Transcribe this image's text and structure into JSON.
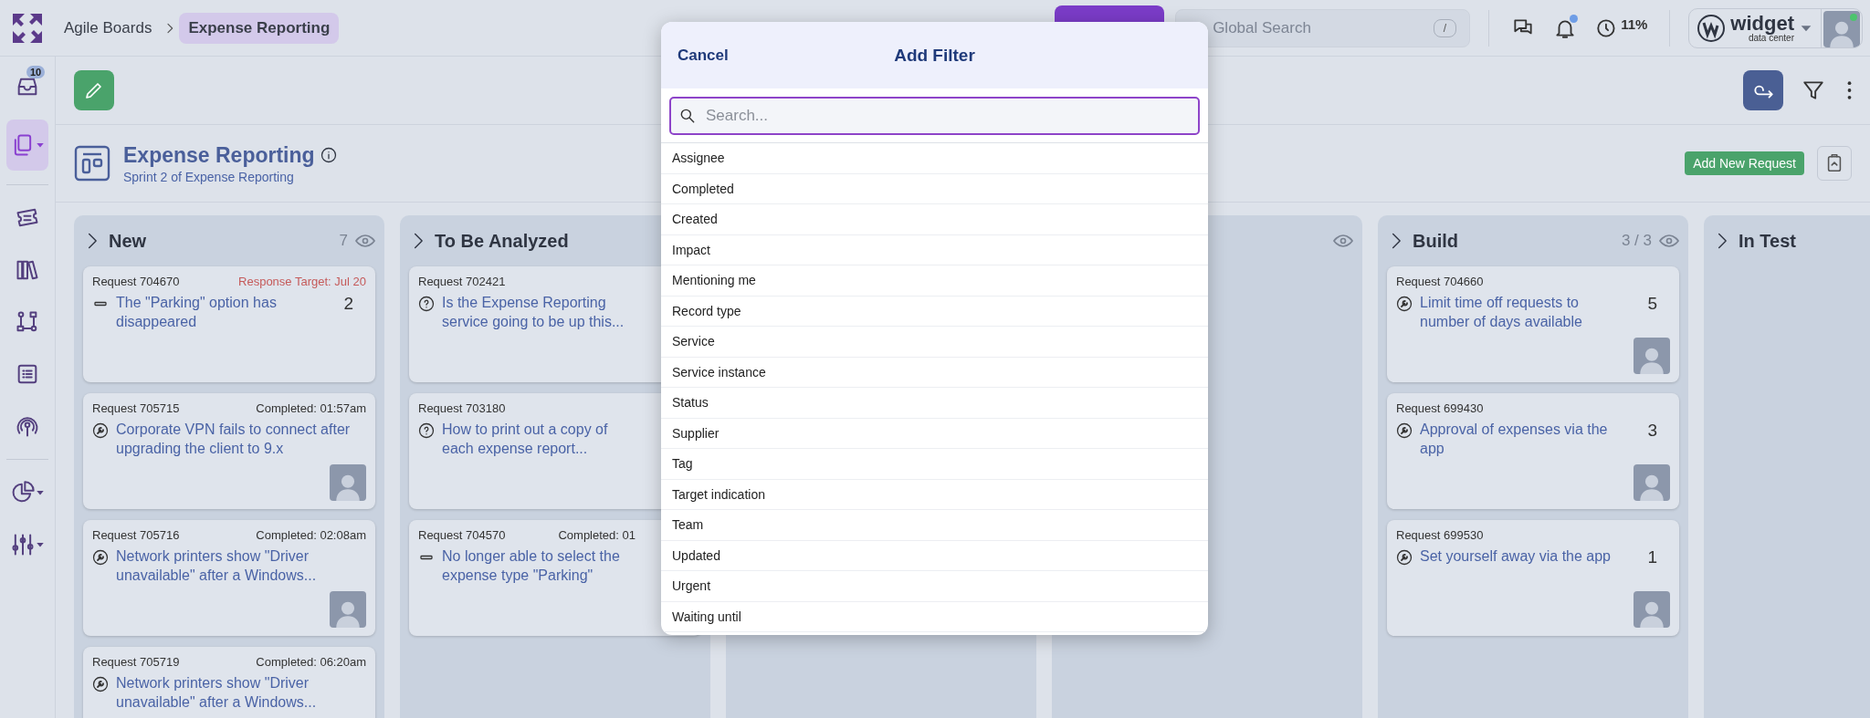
{
  "topbar": {
    "breadcrumb": [
      {
        "label": "Agile Boards",
        "selected": false
      },
      {
        "label": "Expense Reporting",
        "selected": true
      }
    ],
    "search": {
      "placeholder": "Global Search",
      "shortcut": "/"
    },
    "notifications_unread": true,
    "time_reading": "11%",
    "org": {
      "name": "widget",
      "subtitle": "data center"
    },
    "user_online": true
  },
  "sidebar": {
    "items": [
      {
        "kind": "inbox",
        "badge": "10",
        "selected": false,
        "has_menu": false
      },
      {
        "kind": "documents",
        "selected": true,
        "has_menu": true
      },
      {
        "kind": "divider"
      },
      {
        "kind": "ticket",
        "selected": false,
        "has_menu": false
      },
      {
        "kind": "library",
        "selected": false,
        "has_menu": false
      },
      {
        "kind": "workflow",
        "selected": false,
        "has_menu": false
      },
      {
        "kind": "list",
        "selected": false,
        "has_menu": false
      },
      {
        "kind": "radar",
        "selected": false,
        "has_menu": false
      },
      {
        "kind": "divider"
      },
      {
        "kind": "chart",
        "selected": false,
        "has_menu": true
      },
      {
        "kind": "settings",
        "selected": false,
        "has_menu": true
      }
    ]
  },
  "board": {
    "title": "Expense Reporting",
    "subtitle": "Sprint 2 of Expense Reporting",
    "add_button": "Add New Request",
    "columns": [
      {
        "title": "New",
        "count": "7",
        "watch": true,
        "cards": [
          {
            "number": "Request 704670",
            "meta": "Response Target: Jul 20",
            "overdue": true,
            "kind": "dash",
            "title": "The \"Parking\" option has disappeared",
            "count": "2",
            "assigned": false
          },
          {
            "number": "Request 705715",
            "meta": "Completed: 01:57am",
            "overdue": false,
            "kind": "wrench",
            "title": "Corporate VPN fails to connect after upgrading the client to 9.x",
            "assigned": true
          },
          {
            "number": "Request 705716",
            "meta": "Completed: 02:08am",
            "overdue": false,
            "kind": "wrench",
            "title": "Network printers show \"Driver unavailable\" after a Windows...",
            "assigned": true
          },
          {
            "number": "Request 705719",
            "meta": "Completed: 06:20am",
            "overdue": false,
            "kind": "wrench",
            "title": "Network printers show \"Driver unavailable\" after a Windows...",
            "assigned": false
          }
        ]
      },
      {
        "title": "To Be Analyzed",
        "watch": false,
        "cards": [
          {
            "number": "Request 702421",
            "kind": "question",
            "title": "Is the Expense Reporting service going to be up this...",
            "assigned": false
          },
          {
            "number": "Request 703180",
            "kind": "question",
            "title": "How to print out a copy of each expense report...",
            "assigned": false
          },
          {
            "number": "Request 704570",
            "meta": "Completed: 01",
            "overdue": false,
            "kind": "dash",
            "title": "No longer able to select the expense type \"Parking\"",
            "assigned": false
          }
        ]
      },
      {
        "watch": false
      },
      {
        "watch": true
      },
      {
        "title": "Build",
        "count": "3 / 3",
        "watch": true,
        "cards": [
          {
            "number": "Request 704660",
            "kind": "wrench",
            "title": "Limit time off requests to number of days available",
            "count": "5",
            "assigned": true
          },
          {
            "number": "Request 699430",
            "kind": "wrench",
            "title": "Approval of expenses via the app",
            "count": "3",
            "assigned": true
          },
          {
            "number": "Request 699530",
            "kind": "wrench",
            "title": "Set yourself away via the app",
            "count": "1",
            "assigned": true
          }
        ]
      },
      {
        "title": "In Test",
        "watch": false
      }
    ]
  },
  "dialog": {
    "cancel": "Cancel",
    "title": "Add Filter",
    "search": {
      "placeholder": "Search..."
    },
    "options": [
      "Assignee",
      "Completed",
      "Created",
      "Impact",
      "Mentioning me",
      "Record type",
      "Service",
      "Service instance",
      "Status",
      "Supplier",
      "Tag",
      "Target indication",
      "Team",
      "Updated",
      "Urgent",
      "Waiting until"
    ]
  }
}
